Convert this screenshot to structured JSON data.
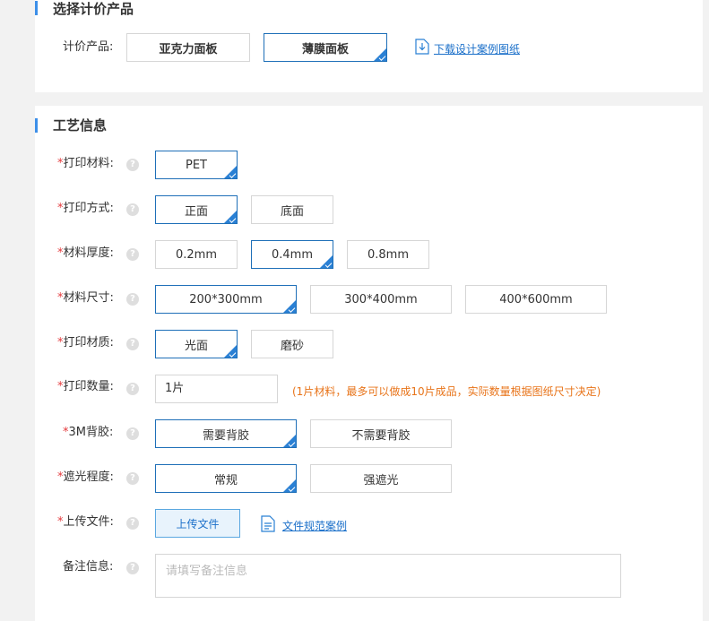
{
  "product_section": {
    "title": "选择计价产品",
    "label": "计价产品:",
    "options": [
      "亚克力面板",
      "薄膜面板"
    ],
    "selected": "薄膜面板",
    "download_link": "下载设计案例图纸"
  },
  "process_section": {
    "title": "工艺信息",
    "required_mark": "*",
    "help_glyph": "?",
    "material": {
      "label": "打印材料:",
      "options": [
        "PET"
      ]
    },
    "method": {
      "label": "打印方式:",
      "options": [
        "正面",
        "底面"
      ]
    },
    "thickness": {
      "label": "材料厚度:",
      "options": [
        "0.2mm",
        "0.4mm",
        "0.8mm"
      ]
    },
    "size": {
      "label": "材料尺寸:",
      "options": [
        "200*300mm",
        "300*400mm",
        "400*600mm"
      ]
    },
    "texture": {
      "label": "打印材质:",
      "options": [
        "光面",
        "磨砂"
      ]
    },
    "quantity": {
      "label": "打印数量:",
      "value": "1片",
      "note": "(1片材料，最多可以做成10片成品，实际数量根据图纸尺寸决定)"
    },
    "adhesive": {
      "label": "3M背胶:",
      "options": [
        "需要背胶",
        "不需要背胶"
      ]
    },
    "shading": {
      "label": "遮光程度:",
      "options": [
        "常规",
        "强遮光"
      ]
    },
    "upload": {
      "label": "上传文件:",
      "button": "上传文件",
      "spec_link": "文件规范案例"
    },
    "remark": {
      "label": "备注信息:",
      "placeholder": "请填写备注信息"
    }
  },
  "colors": {
    "accent": "#2a80d4",
    "required": "#e4393c",
    "note": "#e8741a",
    "link": "#1a6fc9"
  }
}
